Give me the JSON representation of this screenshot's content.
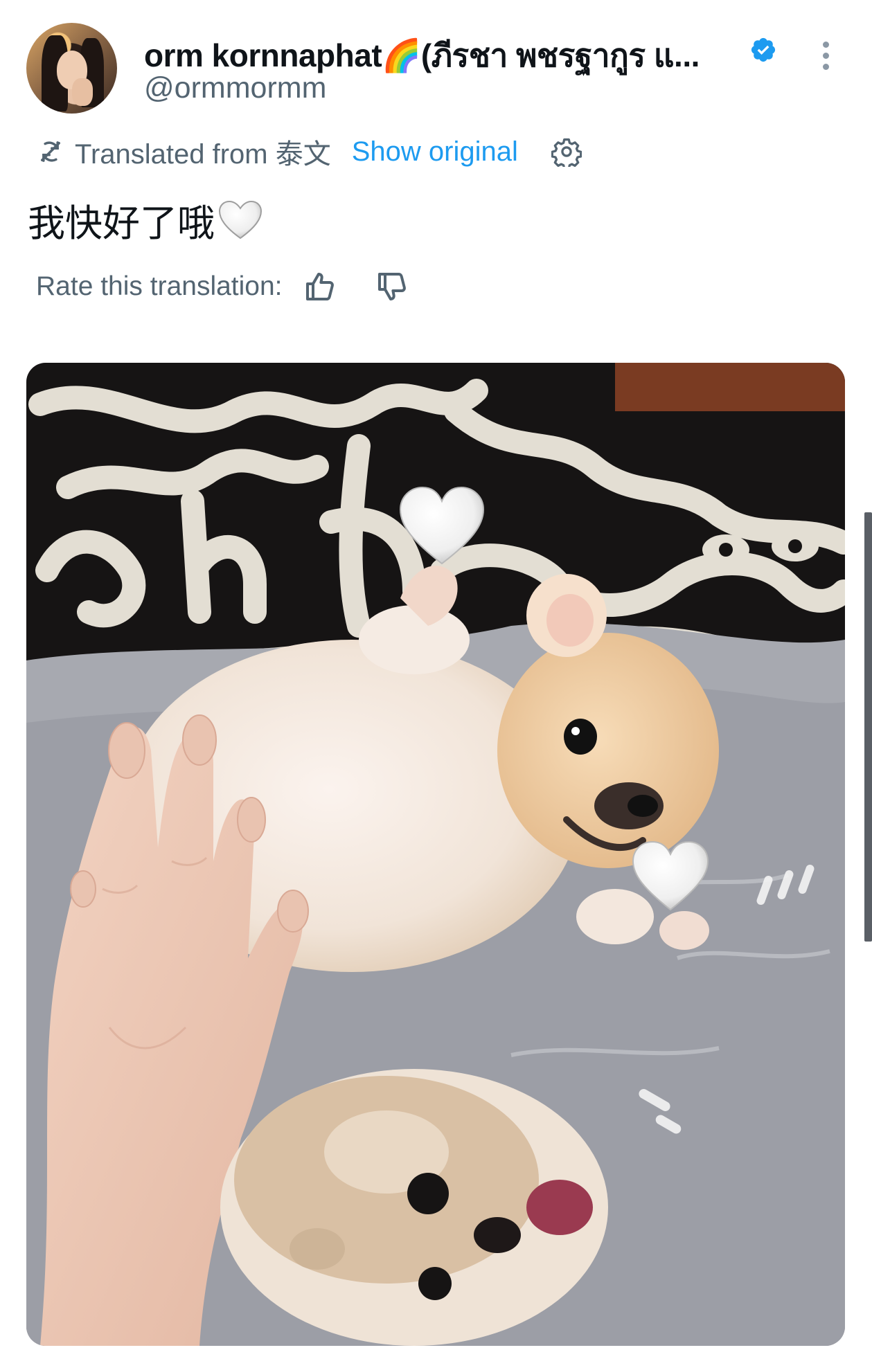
{
  "author": {
    "display_name": "orm kornnaphat🌈(ภีรชา พชรฐากูร แ...",
    "handle": "@ormmormm",
    "verified": true,
    "avatar_icon": "user-avatar"
  },
  "translation": {
    "label": "Translated from 泰文",
    "show_original": "Show original",
    "settings_icon": "gear-icon",
    "translate_icon": "translate-icon"
  },
  "tweet": {
    "text": "我快好了哦",
    "emoji": "white-heart"
  },
  "rate": {
    "label": "Rate this translation:",
    "up_icon": "thumbs-up-icon",
    "down_icon": "thumbs-down-icon"
  },
  "media": {
    "description_icon": "photo",
    "overlay_emoji": "white-heart"
  },
  "colors": {
    "accent": "#1d9bf0",
    "secondary_text": "#536471",
    "verified": "#1d9bf0"
  }
}
